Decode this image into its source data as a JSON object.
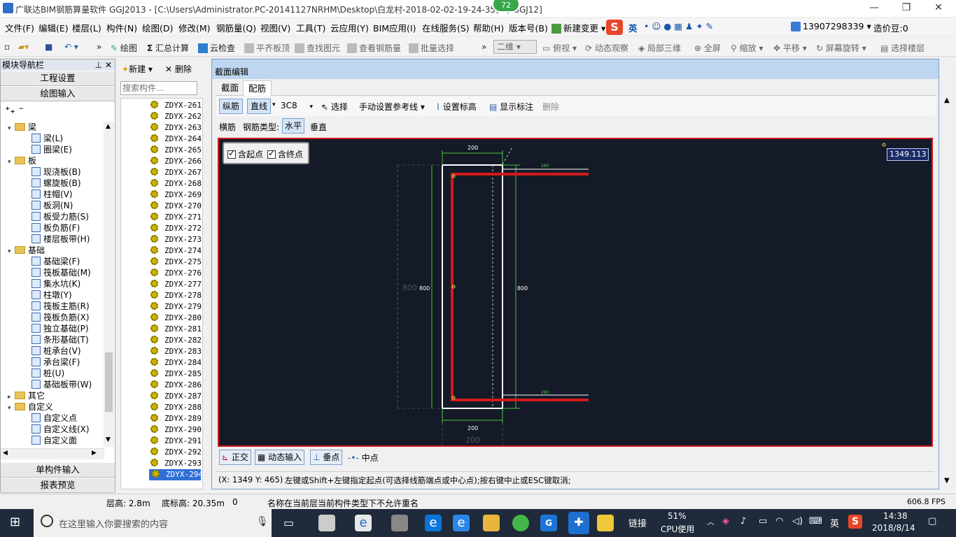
{
  "window": {
    "title": "广联达BIM钢筋算量软件 GGJ2013 - [C:\\Users\\Administrator.PC-20141127NRHM\\Desktop\\白龙村-2018-02-02-19-24-35(...).GGJ12]",
    "badge": "72",
    "min": "—",
    "restore": "❐",
    "close": "✕"
  },
  "menu": [
    "文件(F)",
    "编辑(E)",
    "楼层(L)",
    "构件(N)",
    "绘图(D)",
    "修改(M)",
    "钢筋量(Q)",
    "视图(V)",
    "工具(T)",
    "云应用(Y)",
    "BIM应用(I)",
    "在线服务(S)",
    "帮助(H)",
    "版本号(B)"
  ],
  "menu_right": {
    "new_change": "新建变更",
    "phone": "13907298339",
    "price_bean": "造价豆:0",
    "ime": "英"
  },
  "toolbar": {
    "draw": "绘图",
    "sum": "汇总计算",
    "cloud_check": "云检查",
    "align_top": "平齐板顶",
    "find_elem": "查找图元",
    "view_rebar": "查看钢筋量",
    "batch_select": "批量选择",
    "view_mode": "二维",
    "top_view": "俯视",
    "dynamic_view": "动态观察",
    "local_3d": "局部三维",
    "fullscreen": "全屏",
    "zoom": "缩放",
    "pan": "平移",
    "rotate": "屏幕旋转",
    "select_floor": "选择楼层"
  },
  "nav": {
    "header": "模块导航栏",
    "project_settings": "工程设置",
    "draw_input": "绘图输入",
    "single_input": "单构件输入",
    "report_preview": "报表预览",
    "tree": [
      {
        "label": "梁",
        "level": 0,
        "type": "folder",
        "expanded": true
      },
      {
        "label": "梁(L)",
        "level": 1,
        "type": "item"
      },
      {
        "label": "圈梁(E)",
        "level": 1,
        "type": "item"
      },
      {
        "label": "板",
        "level": 0,
        "type": "folder",
        "expanded": true
      },
      {
        "label": "现浇板(B)",
        "level": 1,
        "type": "item"
      },
      {
        "label": "螺旋板(B)",
        "level": 1,
        "type": "item"
      },
      {
        "label": "柱帽(V)",
        "level": 1,
        "type": "item"
      },
      {
        "label": "板洞(N)",
        "level": 1,
        "type": "item"
      },
      {
        "label": "板受力筋(S)",
        "level": 1,
        "type": "item"
      },
      {
        "label": "板负筋(F)",
        "level": 1,
        "type": "item"
      },
      {
        "label": "楼层板带(H)",
        "level": 1,
        "type": "item"
      },
      {
        "label": "基础",
        "level": 0,
        "type": "folder",
        "expanded": true
      },
      {
        "label": "基础梁(F)",
        "level": 1,
        "type": "item"
      },
      {
        "label": "筏板基础(M)",
        "level": 1,
        "type": "item"
      },
      {
        "label": "集水坑(K)",
        "level": 1,
        "type": "item"
      },
      {
        "label": "柱墩(Y)",
        "level": 1,
        "type": "item"
      },
      {
        "label": "筏板主筋(R)",
        "level": 1,
        "type": "item"
      },
      {
        "label": "筏板负筋(X)",
        "level": 1,
        "type": "item"
      },
      {
        "label": "独立基础(P)",
        "level": 1,
        "type": "item"
      },
      {
        "label": "条形基础(T)",
        "level": 1,
        "type": "item"
      },
      {
        "label": "桩承台(V)",
        "level": 1,
        "type": "item"
      },
      {
        "label": "承台梁(F)",
        "level": 1,
        "type": "item"
      },
      {
        "label": "桩(U)",
        "level": 1,
        "type": "item"
      },
      {
        "label": "基础板带(W)",
        "level": 1,
        "type": "item"
      },
      {
        "label": "其它",
        "level": 0,
        "type": "folder",
        "expanded": false
      },
      {
        "label": "自定义",
        "level": 0,
        "type": "folder",
        "expanded": true
      },
      {
        "label": "自定义点",
        "level": 1,
        "type": "item"
      },
      {
        "label": "自定义线(X)",
        "level": 1,
        "type": "item"
      },
      {
        "label": "自定义面",
        "level": 1,
        "type": "item"
      }
    ]
  },
  "component_list": {
    "new": "新建",
    "delete": "删除",
    "search_placeholder": "搜索构件...",
    "items": [
      "ZDYX-261",
      "ZDYX-262",
      "ZDYX-263",
      "ZDYX-264",
      "ZDYX-265",
      "ZDYX-266",
      "ZDYX-267",
      "ZDYX-268",
      "ZDYX-269",
      "ZDYX-270",
      "ZDYX-271",
      "ZDYX-272",
      "ZDYX-273",
      "ZDYX-274",
      "ZDYX-275",
      "ZDYX-276",
      "ZDYX-277",
      "ZDYX-278",
      "ZDYX-279",
      "ZDYX-280",
      "ZDYX-281",
      "ZDYX-282",
      "ZDYX-283",
      "ZDYX-284",
      "ZDYX-285",
      "ZDYX-286",
      "ZDYX-287",
      "ZDYX-288",
      "ZDYX-289",
      "ZDYX-290",
      "ZDYX-291",
      "ZDYX-292",
      "ZDYX-293",
      "ZDYX-294"
    ],
    "selected": "ZDYX-294"
  },
  "dialog": {
    "title": "截面编辑",
    "tab_section": "截面",
    "tab_rebar": "配筋",
    "longitudinal": "纵筋",
    "line_mode": "直线",
    "spec": "3C8",
    "select": "选择",
    "manual_ref": "手动设置参考线",
    "set_elevation": "设置标高",
    "show_annotation": "显示标注",
    "delete": "删除",
    "stirrup": "横筋",
    "rebar_type_label": "钢筋类型:",
    "horizontal": "水平",
    "vertical": "垂直",
    "include_start": "含起点",
    "include_end": "含终点",
    "coord_value": "1349.113",
    "dims": {
      "top": "200",
      "bottom": "200",
      "bottom_gray": "200",
      "left_inner": "800",
      "left_gray": "800",
      "right": "800",
      "rebar_top": "280",
      "rebar_bottom": "280"
    },
    "bottom_tools": {
      "ortho": "正交",
      "dynamic_input": "动态输入",
      "perpendicular": "垂点",
      "midpoint": "中点"
    },
    "coords": "(X: 1349 Y: 465)",
    "hint": "左键或Shift+左键指定起点(可选择线筋端点或中心点);按右键中止或ESC键取消;"
  },
  "statusbar": {
    "floor_height": "层高: 2.8m",
    "base_elev": "底标高: 20.35m",
    "zero": "0",
    "message": "名称在当前层当前构件类型下不允许重名",
    "fps": "606.8 FPS"
  },
  "taskbar": {
    "search_placeholder": "在这里输入你要搜索的内容",
    "link": "链接",
    "cpu_pct": "51%",
    "cpu_label": "CPU使用",
    "ime": "英",
    "time": "14:38",
    "date": "2018/8/14"
  },
  "colors": {
    "canvas_bg": "#141a28",
    "rebar": "#d21a1a",
    "dim_line": "#4bc43b",
    "outline": "#ffffff"
  }
}
